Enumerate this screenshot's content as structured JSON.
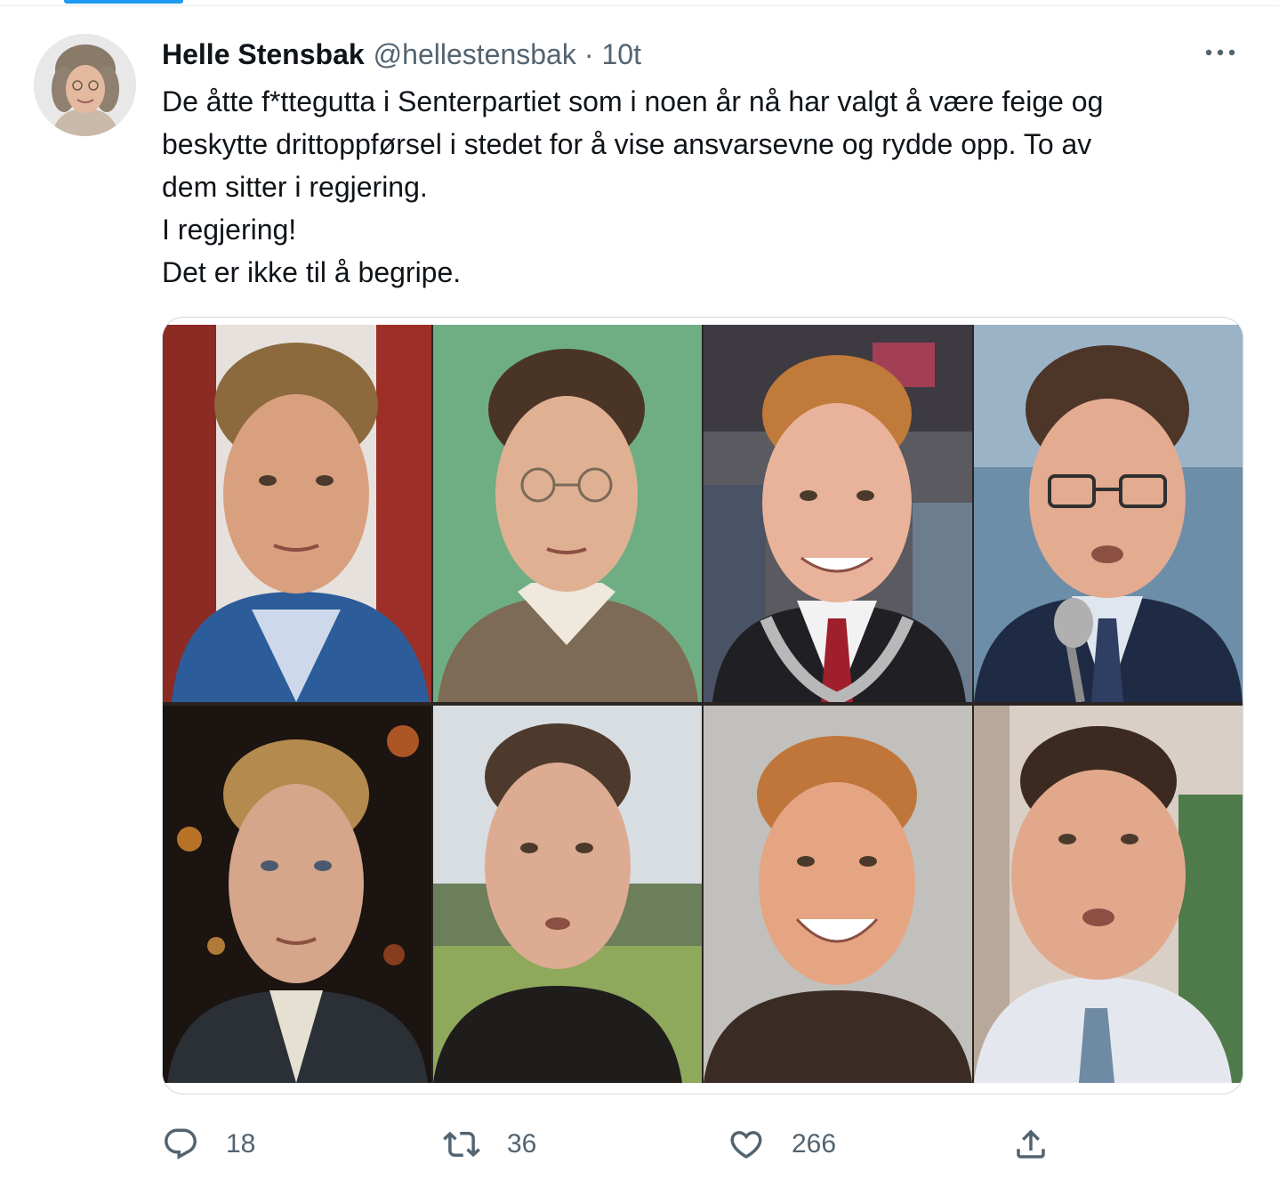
{
  "tweet": {
    "author": {
      "display_name": "Helle Stensbak",
      "handle": "@hellestensbak",
      "separator": "·",
      "time": "10t"
    },
    "text_lines": [
      "De åtte f*ttegutta i Senterpartiet som i noen år nå har valgt å være feige og",
      "beskytte drittoppførsel i stedet for å vise ansvarsevne og rydde opp. To av",
      "dem sitter i regjering.",
      "I regjering!",
      "Det er ikke til å begripe."
    ],
    "media": {
      "photo_count": 8
    },
    "actions": {
      "reply": {
        "icon": "reply-icon",
        "count": "18"
      },
      "retweet": {
        "icon": "retweet-icon",
        "count": "36"
      },
      "like": {
        "icon": "heart-icon",
        "count": "266"
      },
      "share": {
        "icon": "share-icon"
      }
    }
  },
  "colors": {
    "text_primary": "#0f1419",
    "text_secondary": "#536471",
    "accent": "#1d9bf0",
    "border": "#cfd9de"
  }
}
